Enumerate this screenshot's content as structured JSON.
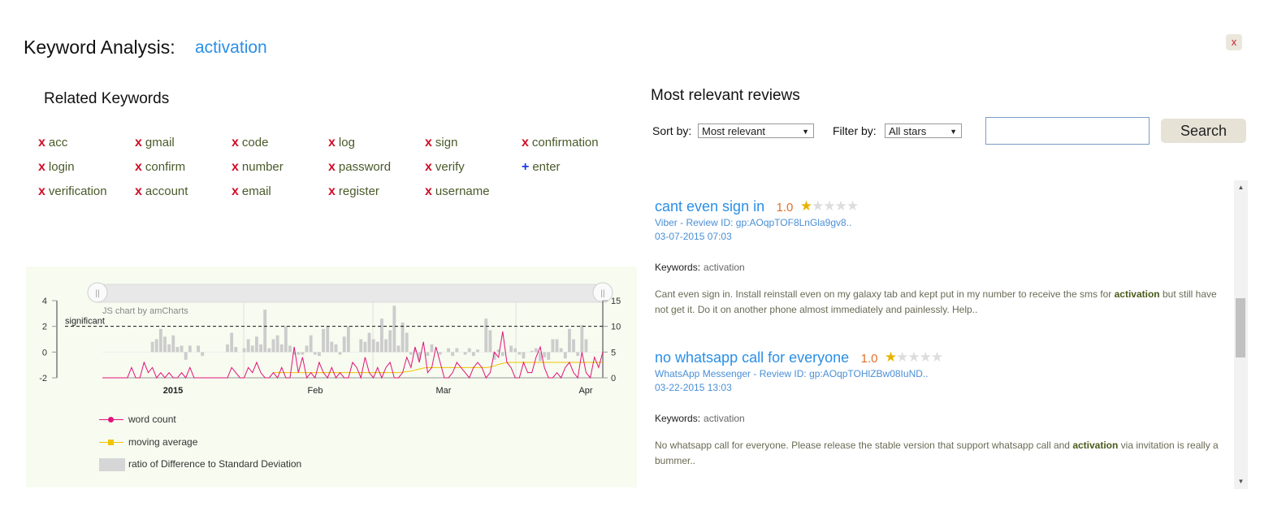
{
  "header": {
    "label": "Keyword Analysis:",
    "keyword": "activation",
    "close_label": "x"
  },
  "related": {
    "title": "Related Keywords",
    "columns": [
      [
        {
          "mark": "x",
          "text": "acc"
        },
        {
          "mark": "x",
          "text": "login"
        },
        {
          "mark": "x",
          "text": "verification"
        }
      ],
      [
        {
          "mark": "x",
          "text": "gmail"
        },
        {
          "mark": "x",
          "text": "confirm"
        },
        {
          "mark": "x",
          "text": "account"
        }
      ],
      [
        {
          "mark": "x",
          "text": "code"
        },
        {
          "mark": "x",
          "text": "number"
        },
        {
          "mark": "x",
          "text": "email"
        }
      ],
      [
        {
          "mark": "x",
          "text": "log"
        },
        {
          "mark": "x",
          "text": "password"
        },
        {
          "mark": "x",
          "text": "register"
        }
      ],
      [
        {
          "mark": "x",
          "text": "sign"
        },
        {
          "mark": "x",
          "text": "verify"
        },
        {
          "mark": "x",
          "text": "username"
        }
      ],
      [
        {
          "mark": "x",
          "text": "confirmation"
        },
        {
          "mark": "+",
          "text": "enter"
        }
      ]
    ]
  },
  "chart_data": {
    "type": "line",
    "watermark": "JS chart by amCharts",
    "threshold_label": "significant",
    "threshold_value": 2,
    "left_axis": {
      "ticks": [
        "4",
        "2",
        "0",
        "-2"
      ],
      "ylim": [
        -2,
        4
      ]
    },
    "right_axis": {
      "ticks": [
        "15",
        "10",
        "5",
        "0"
      ],
      "ylim": [
        0,
        15
      ]
    },
    "x_ticks": [
      "2015",
      "Feb",
      "Mar",
      "Apr"
    ],
    "colors": {
      "word_count": "#e0147a",
      "moving_average": "#f0c400",
      "ratio": "#cccccc",
      "background": "#f7fbf0"
    },
    "legend": [
      "word count",
      "moving average",
      "ratio of Difference to Standard Deviation"
    ],
    "series": [
      {
        "name": "word count",
        "axis": "right",
        "values": [
          0,
          0,
          0,
          0,
          0,
          0,
          0,
          2,
          0,
          0,
          3,
          1,
          2,
          0,
          1,
          0,
          1,
          0,
          0,
          1,
          0,
          2,
          0,
          0,
          0,
          0,
          0,
          0,
          0,
          0,
          0,
          2,
          1,
          0,
          0,
          2,
          1,
          3,
          1,
          0,
          0,
          1,
          0,
          2,
          0,
          0,
          6,
          1,
          4,
          0,
          1,
          0,
          3,
          1,
          0,
          2,
          0,
          1,
          0,
          0,
          3,
          2,
          0,
          4,
          1,
          0,
          2,
          0,
          2,
          3,
          0,
          0,
          1,
          4,
          2,
          6,
          3,
          7,
          1,
          2,
          6,
          3,
          0,
          0,
          1,
          3,
          2,
          1,
          0,
          2,
          3,
          2,
          0,
          1,
          5,
          4,
          9,
          3,
          2,
          0,
          0,
          3,
          1,
          1,
          4,
          6,
          2,
          0,
          0,
          1,
          0,
          2,
          3,
          1,
          0,
          5,
          1,
          0,
          4,
          2,
          5
        ]
      },
      {
        "name": "moving average",
        "axis": "right",
        "values": [
          null,
          null,
          null,
          null,
          null,
          null,
          null,
          null,
          null,
          null,
          null,
          null,
          null,
          null,
          null,
          null,
          null,
          null,
          null,
          null,
          null,
          null,
          null,
          null,
          null,
          null,
          null,
          null,
          null,
          null,
          null,
          null,
          null,
          null,
          null,
          null,
          null,
          null,
          null,
          null,
          null,
          1,
          1,
          1,
          1,
          1,
          1,
          1,
          1,
          1,
          1,
          1,
          1,
          1,
          1,
          1,
          1,
          1,
          1,
          1,
          1,
          1,
          1,
          1,
          1,
          1,
          1,
          1,
          1,
          1,
          1,
          1,
          1.1,
          1.2,
          1.3,
          1.5,
          1.7,
          1.9,
          2,
          2,
          2,
          2,
          2,
          2,
          2,
          2,
          2,
          2,
          2,
          2,
          2,
          2,
          2,
          2.1,
          2.3,
          2.6,
          2.8,
          3,
          3,
          3,
          3,
          3,
          3,
          3,
          3,
          3,
          3,
          3,
          3,
          3,
          3,
          3,
          3,
          3,
          3,
          3,
          3,
          3,
          3,
          3,
          3
        ]
      },
      {
        "name": "ratio of Difference to Standard Deviation",
        "axis": "left",
        "values": [
          0,
          0,
          0,
          0,
          0,
          0,
          0,
          0,
          0,
          0,
          0,
          0,
          0,
          0,
          0,
          0,
          0,
          0,
          0,
          0,
          0,
          0,
          0,
          0,
          0,
          0,
          0,
          0,
          0,
          0,
          0,
          0,
          0,
          0,
          0,
          0,
          0,
          0,
          0,
          0,
          0,
          0,
          0,
          0,
          0,
          0,
          0,
          0,
          0,
          0,
          0,
          0,
          0,
          0,
          0,
          0,
          0,
          0,
          0,
          0,
          0,
          0,
          0,
          0,
          0,
          0,
          0,
          0,
          0,
          0,
          0,
          0,
          0,
          0,
          0,
          0,
          0,
          0,
          0,
          0,
          0,
          0,
          0,
          0,
          0,
          0,
          0,
          0,
          0,
          0,
          0,
          0,
          0,
          0,
          0,
          0,
          0,
          0,
          0,
          0,
          0,
          0,
          0,
          0,
          0,
          0,
          0,
          0,
          0,
          0,
          0,
          0,
          0,
          0,
          0,
          0,
          0,
          0,
          0,
          0,
          0
        ]
      }
    ],
    "bars": [
      [
        0,
        0
      ],
      [
        1,
        0
      ],
      [
        2,
        0
      ],
      [
        3,
        0
      ],
      [
        4,
        0
      ],
      [
        5,
        0
      ],
      [
        6,
        0
      ],
      [
        7,
        0
      ],
      [
        8,
        0
      ],
      [
        9,
        0
      ],
      [
        10,
        0
      ],
      [
        11,
        0
      ],
      [
        12,
        0.8
      ],
      [
        13,
        1
      ],
      [
        14,
        1.8
      ],
      [
        15,
        1.2
      ],
      [
        16,
        0.6
      ],
      [
        17,
        1.3
      ],
      [
        18,
        0.4
      ],
      [
        19,
        0.5
      ],
      [
        20,
        -0.6
      ],
      [
        21,
        0.5
      ],
      [
        22,
        0
      ],
      [
        23,
        0.5
      ],
      [
        24,
        -0.3
      ],
      [
        25,
        0
      ],
      [
        30,
        0.6
      ],
      [
        31,
        1.5
      ],
      [
        32,
        0.4
      ],
      [
        33,
        0
      ],
      [
        34,
        0.3
      ],
      [
        35,
        1
      ],
      [
        36,
        0.5
      ],
      [
        37,
        1.2
      ],
      [
        38,
        0.6
      ],
      [
        39,
        3.3
      ],
      [
        40,
        0.3
      ],
      [
        41,
        1
      ],
      [
        42,
        1.3
      ],
      [
        43,
        0.6
      ],
      [
        44,
        2
      ],
      [
        45,
        0.5
      ],
      [
        46,
        -0.2
      ],
      [
        47,
        -0.2
      ],
      [
        48,
        -0.2
      ],
      [
        49,
        0.5
      ],
      [
        50,
        1.3
      ],
      [
        51,
        -0.2
      ],
      [
        52,
        -0.3
      ],
      [
        53,
        1.8
      ],
      [
        54,
        2
      ],
      [
        55,
        0.8
      ],
      [
        56,
        0.6
      ],
      [
        57,
        -0.2
      ],
      [
        58,
        1.2
      ],
      [
        59,
        2
      ],
      [
        60,
        0
      ],
      [
        62,
        1
      ],
      [
        63,
        0.8
      ],
      [
        64,
        1.5
      ],
      [
        65,
        1
      ],
      [
        66,
        0.8
      ],
      [
        67,
        2.6
      ],
      [
        68,
        1
      ],
      [
        69,
        1.7
      ],
      [
        70,
        3.6
      ],
      [
        71,
        0.5
      ],
      [
        72,
        2.3
      ],
      [
        73,
        1.5
      ],
      [
        74,
        -0.2
      ],
      [
        75,
        0.2
      ],
      [
        76,
        -0.6
      ],
      [
        77,
        0
      ],
      [
        78,
        -0.3
      ],
      [
        79,
        0.6
      ],
      [
        80,
        0
      ],
      [
        81,
        -0.2
      ],
      [
        82,
        0
      ],
      [
        83,
        0.3
      ],
      [
        84,
        -0.3
      ],
      [
        85,
        0.3
      ],
      [
        86,
        0
      ],
      [
        87,
        -0.2
      ],
      [
        88,
        0.3
      ],
      [
        89,
        -0.3
      ],
      [
        90,
        0.2
      ],
      [
        91,
        0
      ],
      [
        92,
        2.6
      ],
      [
        93,
        1.7
      ],
      [
        94,
        -0.6
      ],
      [
        95,
        0.2
      ],
      [
        96,
        -0.3
      ],
      [
        97,
        0
      ],
      [
        98,
        0.5
      ],
      [
        99,
        0.3
      ],
      [
        100,
        -0.2
      ],
      [
        101,
        -0.5
      ],
      [
        102,
        0
      ],
      [
        103,
        0.1
      ],
      [
        104,
        0.3
      ],
      [
        105,
        -0.7
      ],
      [
        106,
        -0.4
      ],
      [
        107,
        -0.6
      ],
      [
        108,
        1
      ],
      [
        109,
        1
      ],
      [
        110,
        0.3
      ],
      [
        111,
        -0.5
      ],
      [
        112,
        1.8
      ],
      [
        113,
        1
      ],
      [
        114,
        -0.3
      ],
      [
        115,
        2.1
      ],
      [
        116,
        1
      ]
    ]
  },
  "reviews": {
    "title": "Most relevant reviews",
    "sort_label": "Sort by:",
    "sort_value": "Most relevant",
    "filter_label": "Filter by:",
    "filter_value": "All stars",
    "search_value": "",
    "search_button": "Search",
    "keywords_label": "Keywords:",
    "items": [
      {
        "title": "cant even sign in",
        "rating": "1.0",
        "stars": 1,
        "meta": "Viber - Review ID: gp:AOqpTOF8LnGla9gv8..",
        "date": "03-07-2015 07:03",
        "keywords": "activation",
        "body_before": "Cant even sign in. Install reinstall even on my galaxy tab and kept put in my number to receive the sms for ",
        "body_highlight": "activation",
        "body_after": " but still have not get it. Do it on another phone almost immediately and painlessly. Help.."
      },
      {
        "title": "no whatsapp call for everyone",
        "rating": "1.0",
        "stars": 1,
        "meta": "WhatsApp Messenger - Review ID: gp:AOqpTOHlZBw08IuND..",
        "date": "03-22-2015 13:03",
        "keywords": "activation",
        "body_before": "No whatsapp call for everyone. Please release the stable version that support whatsapp call and ",
        "body_highlight": "activation",
        "body_after": " via invitation is really a bummer.."
      }
    ]
  }
}
